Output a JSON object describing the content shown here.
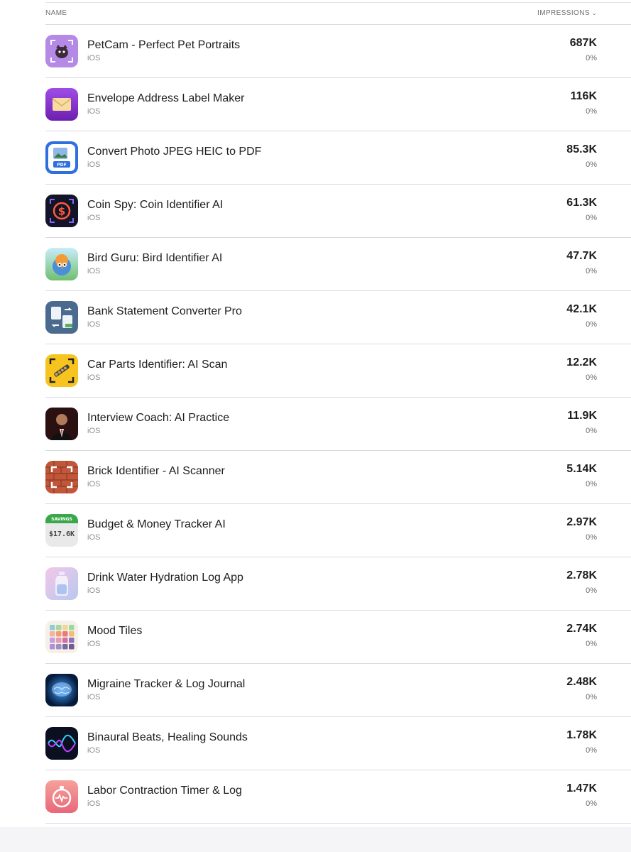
{
  "header": {
    "name_label": "NAME",
    "impressions_label": "IMPRESSIONS",
    "sort_icon": "chevron-down-icon"
  },
  "apps": [
    {
      "name": "PetCam - Perfect Pet Portraits",
      "platform": "iOS",
      "impressions": "687K",
      "change": "0%",
      "icon": "petcam-icon",
      "color": "#b48ae6"
    },
    {
      "name": "Envelope Address Label Maker",
      "platform": "iOS",
      "impressions": "116K",
      "change": "0%",
      "icon": "envelope-icon",
      "color": "#8a2be2"
    },
    {
      "name": "Convert Photo JPEG HEIC to PDF",
      "platform": "iOS",
      "impressions": "85.3K",
      "change": "0%",
      "icon": "photo-pdf-icon",
      "color": "#2f6fe0"
    },
    {
      "name": "Coin Spy: Coin Identifier AI",
      "platform": "iOS",
      "impressions": "61.3K",
      "change": "0%",
      "icon": "coin-icon",
      "color": "#141428"
    },
    {
      "name": "Bird Guru: Bird Identifier AI",
      "platform": "iOS",
      "impressions": "47.7K",
      "change": "0%",
      "icon": "bird-icon",
      "color": "#8fd3f0"
    },
    {
      "name": "Bank Statement Converter Pro",
      "platform": "iOS",
      "impressions": "42.1K",
      "change": "0%",
      "icon": "bank-statement-icon",
      "color": "#4a6a8f"
    },
    {
      "name": "Car Parts Identifier: AI Scan",
      "platform": "iOS",
      "impressions": "12.2K",
      "change": "0%",
      "icon": "car-parts-icon",
      "color": "#f7c41f"
    },
    {
      "name": "Interview Coach: AI Practice",
      "platform": "iOS",
      "impressions": "11.9K",
      "change": "0%",
      "icon": "interview-coach-icon",
      "color": "#2a1414"
    },
    {
      "name": "Brick Identifier - AI Scanner",
      "platform": "iOS",
      "impressions": "5.14K",
      "change": "0%",
      "icon": "brick-icon",
      "color": "#c0573a"
    },
    {
      "name": "Budget & Money Tracker AI",
      "platform": "iOS",
      "impressions": "2.97K",
      "change": "0%",
      "icon": "savings-icon",
      "color": "#3aa84a",
      "icon_text_top": "SAVINGS",
      "icon_text_main": "$17.6K"
    },
    {
      "name": "Drink Water Hydration Log App",
      "platform": "iOS",
      "impressions": "2.78K",
      "change": "0%",
      "icon": "water-bottle-icon",
      "color": "#e6b8e6"
    },
    {
      "name": "Mood Tiles",
      "platform": "iOS",
      "impressions": "2.74K",
      "change": "0%",
      "icon": "mood-tiles-icon",
      "color": "#f5f0ea"
    },
    {
      "name": "Migraine Tracker & Log Journal",
      "platform": "iOS",
      "impressions": "2.48K",
      "change": "0%",
      "icon": "brain-icon",
      "color": "#0a2a5a"
    },
    {
      "name": "Binaural Beats, Healing Sounds",
      "platform": "iOS",
      "impressions": "1.78K",
      "change": "0%",
      "icon": "wave-icon",
      "color": "#0b1020"
    },
    {
      "name": "Labor Contraction Timer & Log",
      "platform": "iOS",
      "impressions": "1.47K",
      "change": "0%",
      "icon": "stopwatch-icon",
      "color": "#f08080"
    }
  ]
}
